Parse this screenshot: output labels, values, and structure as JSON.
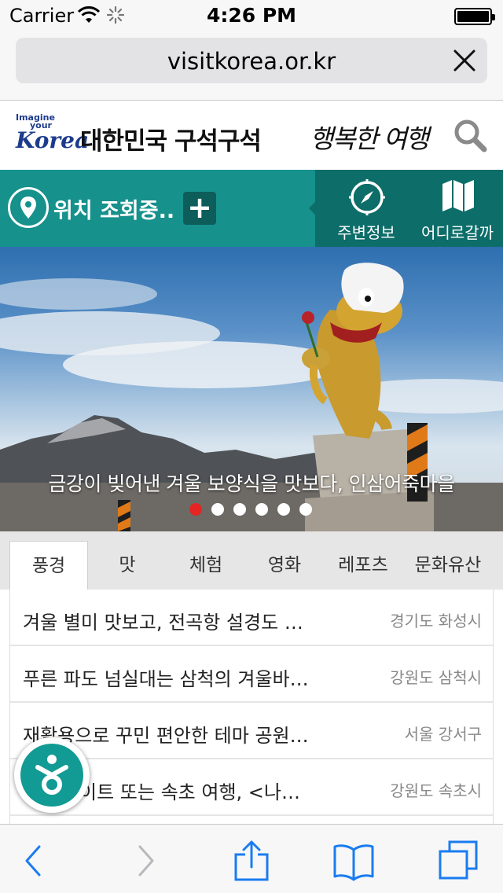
{
  "status_bar": {
    "carrier": "Carrier",
    "time": "4:26 PM",
    "icons": [
      "wifi-icon",
      "loading-spinner-icon",
      "battery-icon"
    ]
  },
  "address_bar": {
    "url": "visitkorea.or.kr",
    "clear_icon": "close-icon"
  },
  "site_header": {
    "logo": {
      "line1": "Imagine",
      "line2": "your",
      "wordmark": "Korea"
    },
    "title": "대한민국 구석구석",
    "slogan": "행복한 여행",
    "search_icon": "search-icon"
  },
  "location_bar": {
    "status_text": "위치 조회중..",
    "add_label": "+",
    "nearby_label": "주변정보",
    "where_label": "어디로갈까"
  },
  "hero": {
    "caption": "금강이 빚어낸 겨울 보양식을 맛보다, 인삼어죽마을",
    "slide_count": 6,
    "active_slide": 1
  },
  "tabs": [
    {
      "label": "풍경",
      "active": true
    },
    {
      "label": "맛",
      "active": false
    },
    {
      "label": "체험",
      "active": false
    },
    {
      "label": "영화",
      "active": false
    },
    {
      "label": "레포츠",
      "active": false
    },
    {
      "label": "문화유산",
      "active": false
    }
  ],
  "list": [
    {
      "title": "겨울 별미 맛보고, 전곡항 설경도 …",
      "region": "경기도 화성시"
    },
    {
      "title": "푸른 파도 넘실대는 삼척의 겨울바…",
      "region": "강원도 삼척시"
    },
    {
      "title": "재활용으로 꾸민 편안한 테마 공원…",
      "region": "서울 강서구"
    },
    {
      "title": "이트 또는 속초 여행, <나…",
      "region": "강원도 속초시"
    }
  ],
  "toolbar": {
    "buttons": [
      "back-icon",
      "forward-icon",
      "share-icon",
      "bookmarks-icon",
      "tabs-icon"
    ]
  },
  "colors": {
    "teal": "#16918c",
    "teal_dark": "#0d6d69",
    "ios_blue": "#1a7cf0",
    "active_dot": "#e52424"
  }
}
